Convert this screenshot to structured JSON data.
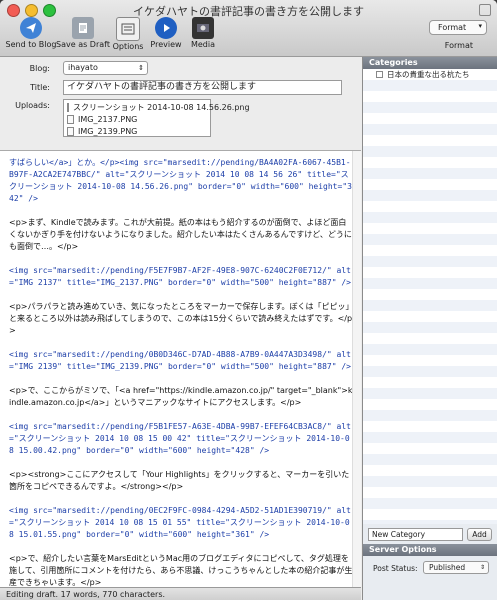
{
  "window": {
    "title": "イケダハヤトの書評記事の書き方を公開します"
  },
  "toolbar": {
    "send_label": "Send to Blog",
    "draft_label": "Save as Draft",
    "options_label": "Options",
    "preview_label": "Preview",
    "media_label": "Media",
    "format_value": "Format",
    "format_label": "Format"
  },
  "fields": {
    "blog_label": "Blog:",
    "blog_value": "ihayato",
    "title_label": "Title:",
    "title_value": "イケダハヤトの書評記事の書き方を公開します",
    "uploads_label": "Uploads:",
    "uploads": [
      "スクリーンショット 2014-10-08 14.56.26.png",
      "IMG_2137.PNG",
      "IMG_2139.PNG"
    ]
  },
  "editor": {
    "paragraphs": [
      "すばらしい</a>」とか。</p><img src=\"marsedit://pending/BA4A02FA-6067-45B1-B97F-A2CA2E747BBC/\" alt=\"スクリーンショット 2014 10 08 14 56 26\" title=\"スクリーンショット 2014-10-08 14.56.26.png\" border=\"0\" width=\"600\" height=\"342\" />",
      "<p>まず、Kindleで読みます。これが大前提。紙の本はもう紹介するのが面倒で、よほど面白くないかぎり手を付けないようになりました。紹介したい本はたくさんあるんですけど、どうにも面倒で…。</p>",
      "<img src=\"marsedit://pending/F5E7F9B7-AF2F-49E8-907C-6240C2F0E712/\" alt=\"IMG 2137\" title=\"IMG_2137.PNG\" border=\"0\" width=\"500\" height=\"887\" />",
      "<p>パラパラと読み進めていき、気になったところをマーカーで保存します。ぼくは「ピピッ」と来るところ以外は読み飛ばしてしまうので、この本は15分くらいで読み終えたはずです。</p>",
      "<img src=\"marsedit://pending/0B0D346C-D7AD-4B88-A7B9-0A447A3D3498/\" alt=\"IMG 2139\" title=\"IMG_2139.PNG\" border=\"0\" width=\"500\" height=\"887\" />",
      "<p>で、ここからがミソで、「<a href=\"https://kindle.amazon.co.jp/\" target=\"_blank\">kindle.amazon.co.jp</a>」というマニアックなサイトにアクセスします。</p>",
      "<img src=\"marsedit://pending/F5B1FE57-A63E-4DBA-99B7-EFEF64CB3AC8/\" alt=\"スクリーンショット 2014 10 08 15 00 42\" title=\"スクリーンショット 2014-10-08 15.00.42.png\" border=\"0\" width=\"600\" height=\"428\" />",
      "<p><strong>ここにアクセスして「Your Highlights」をクリックすると、マーカーを引いた箇所をコピペできるんですよ。</strong></p>",
      "<img src=\"marsedit://pending/0EC2F9FC-0984-4294-A5D2-51AD1E390719/\" alt=\"スクリーンショット 2014 10 08 15 01 55\" title=\"スクリーンショット 2014-10-08 15.01.55.png\" border=\"0\" width=\"600\" height=\"361\" />",
      "<p>で、紹介したい言葉をMarsEditというMac用のブログエディタにコピペして、タグ処理を施して、引用箇所にコメントを付けたら、あら不思議、けっこうちゃんとした本の紹介記事が生産できちゃいます。</p>"
    ]
  },
  "status": {
    "text": "Editing draft. 17 words, 770 characters."
  },
  "categories": {
    "header": "Categories",
    "items": [
      "日本の貴重な出る杭たち"
    ],
    "new_placeholder": "New Category",
    "add_label": "Add"
  },
  "server_options": {
    "header": "Server Options",
    "post_status_label": "Post Status:",
    "post_status_value": "Published"
  }
}
